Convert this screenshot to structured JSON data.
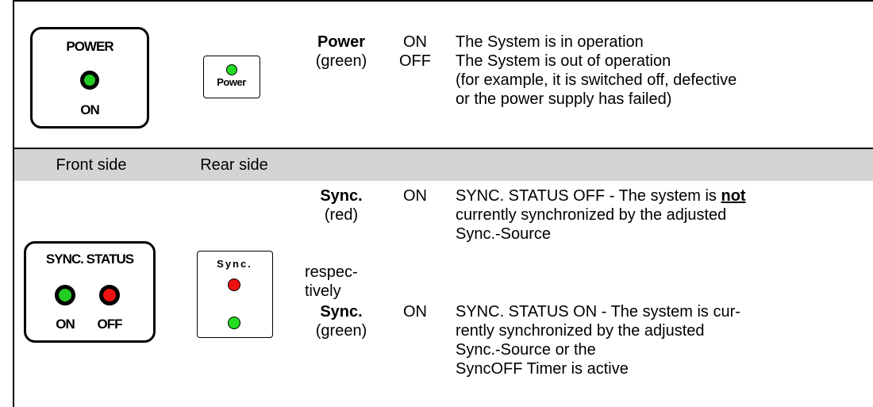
{
  "power_row": {
    "front_panel": {
      "top_label": "POWER",
      "bottom_label": "ON",
      "led_color": "#22cc22"
    },
    "rear_panel": {
      "label": "Power",
      "led_color": "#22dd22"
    },
    "name": "Power",
    "color": "(green)",
    "states": [
      "ON",
      "OFF"
    ],
    "descriptions": [
      "The System is in operation",
      "The System is out of operation",
      "(for example, it is switched off, defective",
      "or the power supply has failed)"
    ]
  },
  "header_band": {
    "front_label": "Front side",
    "rear_label": "Rear side"
  },
  "sync_row": {
    "front_panel": {
      "top_label": "SYNC. STATUS",
      "bottom_label_on": "ON",
      "bottom_label_off": "OFF",
      "led_on_color": "#22cc22",
      "led_off_color": "#ee1111"
    },
    "rear_panel": {
      "label": "Sync.",
      "led_red": "#ee1111",
      "led_green": "#22dd22"
    },
    "red_entry": {
      "name": "Sync.",
      "color": "(red)",
      "state": "ON",
      "desc_line1_prefix": "SYNC. STATUS OFF - The system is ",
      "desc_line1_emph": "not",
      "desc_line2": "currently synchronized by the adjusted",
      "desc_line3": "Sync.-Source"
    },
    "respectively_1": "respec-",
    "respectively_2": "tively",
    "green_entry": {
      "name": "Sync.",
      "color": "(green)",
      "state": "ON",
      "desc_line1": "SYNC. STATUS ON - The system is cur-",
      "desc_line2": "rently synchronized by the adjusted",
      "desc_line3": "Sync.-Source or the",
      "desc_line4": "SyncOFF Timer is active"
    }
  }
}
